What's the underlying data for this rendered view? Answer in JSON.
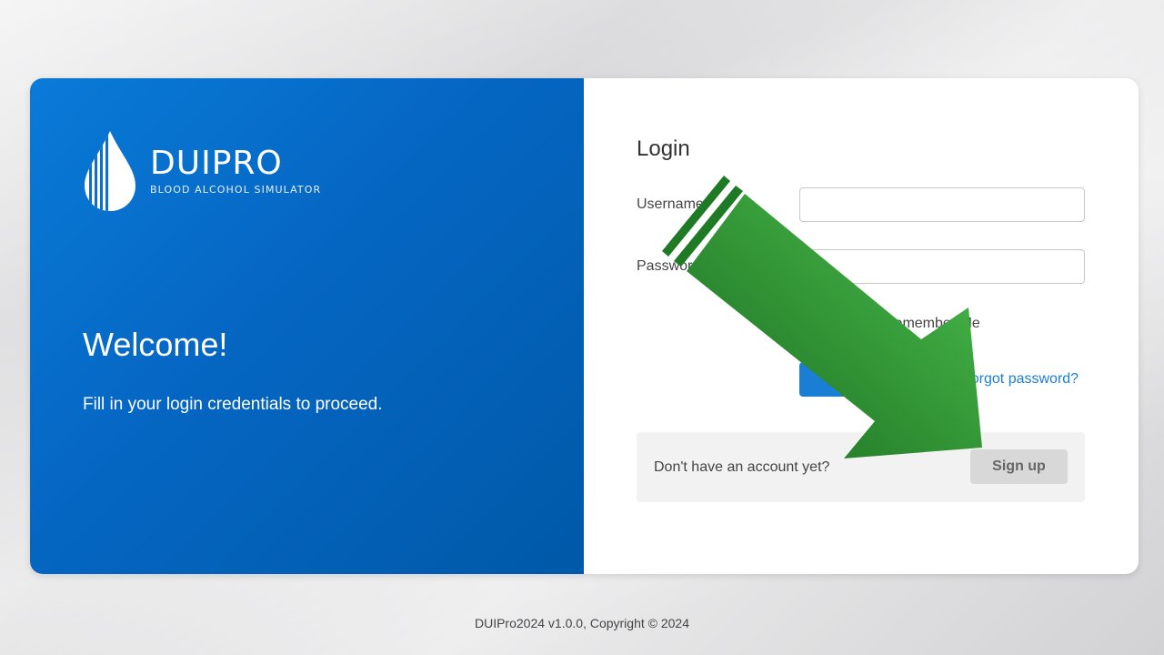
{
  "brand": {
    "name": "DUIPRO",
    "tagline": "BLOOD ALCOHOL SIMULATOR"
  },
  "left": {
    "heading": "Welcome!",
    "subtitle": "Fill in your login credentials to proceed."
  },
  "login": {
    "title": "Login",
    "username_label": "Username",
    "username_value": "",
    "password_label": "Password",
    "password_value": "",
    "remember_label": "Remember Me",
    "login_button": "Login",
    "forgot_link": "Forgot password?"
  },
  "signup": {
    "prompt": "Don't have an account yet?",
    "button": "Sign up"
  },
  "footer": {
    "text": "DUIPro2024 v1.0.0, Copyright © 2024"
  },
  "annotation": {
    "arrow_icon": "arrow-down-right-icon",
    "color_light": "#4cc14e",
    "color_dark": "#1a6a1f"
  },
  "colors": {
    "panel_blue": "#0566c2",
    "link_blue": "#1a7fd4",
    "signup_bg": "#f2f2f2"
  }
}
